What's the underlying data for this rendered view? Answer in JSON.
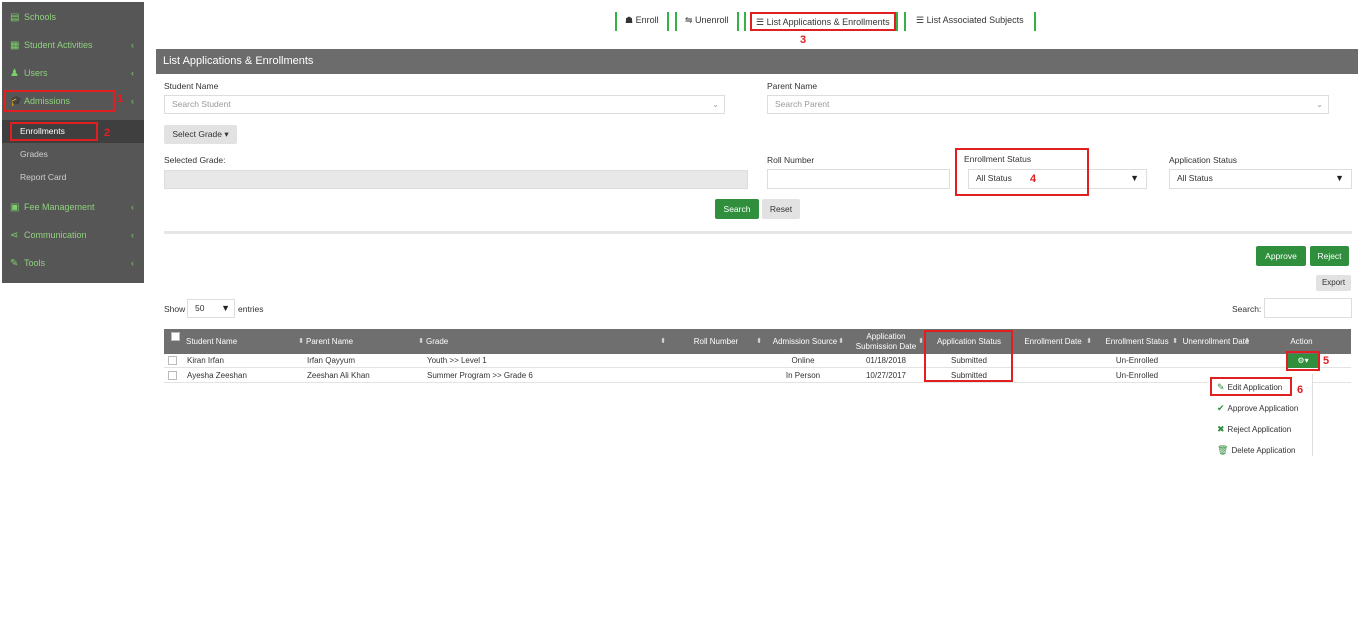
{
  "sidebar": {
    "items": [
      {
        "label": "Schools",
        "icon": "school-icon"
      },
      {
        "label": "Student Activities",
        "icon": "activities-icon"
      },
      {
        "label": "Users",
        "icon": "users-icon"
      },
      {
        "label": "Admissions",
        "icon": "graduation-cap-icon"
      },
      {
        "label": "Fee Management",
        "icon": "fee-icon"
      },
      {
        "label": "Communication",
        "icon": "share-icon"
      },
      {
        "label": "Tools",
        "icon": "wrench-icon"
      }
    ],
    "subitems": [
      "Enrollments",
      "Grades",
      "Report Card"
    ]
  },
  "top_tabs": [
    "Enroll",
    "Unenroll",
    "List Applications & Enrollments",
    "List Associated Subjects"
  ],
  "annotations": [
    "1",
    "2",
    "3",
    "4",
    "5",
    "6"
  ],
  "panel": {
    "title": "List Applications & Enrollments",
    "student_name_label": "Student Name",
    "student_name_placeholder": "Search Student",
    "parent_name_label": "Parent Name",
    "parent_name_placeholder": "Search Parent",
    "select_grade_button": "Select Grade",
    "selected_grade_label": "Selected Grade:",
    "roll_number_label": "Roll Number",
    "enrollment_status_label": "Enrollment Status",
    "enrollment_status_value": "All Status",
    "application_status_label": "Application Status",
    "application_status_value": "All Status",
    "search_button": "Search",
    "reset_button": "Reset",
    "approve_button": "Approve",
    "reject_button": "Reject",
    "export_button": "Export",
    "show_label": "Show",
    "entries_value": "50",
    "entries_label": "entries",
    "search_label": "Search:"
  },
  "table": {
    "headers": [
      "Student Name",
      "Parent Name",
      "Grade",
      "Roll Number",
      "Admission Source",
      "Application Submission Date",
      "Application Status",
      "Enrollment Date",
      "Enrollment Status",
      "Unenrollment Date",
      "Action"
    ],
    "rows": [
      {
        "student": "Kiran Irfan",
        "parent": "Irfan Qayyum",
        "grade": "Youth >> Level 1",
        "roll": "",
        "source": "Online",
        "submitted": "01/18/2018",
        "app_status": "Submitted",
        "enroll_date": "",
        "enroll_status": "Un-Enrolled",
        "unenroll_date": ""
      },
      {
        "student": "Ayesha Zeeshan",
        "parent": "Zeeshan Ali Khan",
        "grade": "Summer Program >> Grade 6",
        "roll": "",
        "source": "In Person",
        "submitted": "10/27/2017",
        "app_status": "Submitted",
        "enroll_date": "",
        "enroll_status": "Un-Enrolled",
        "unenroll_date": ""
      }
    ]
  },
  "action_menu": [
    "Edit Application",
    "Approve Application",
    "Reject Application",
    "Delete Application"
  ],
  "colors": {
    "accent_green": "#2f8f3c",
    "sidebar_bg": "#565656",
    "annotation_red": "#e02020"
  }
}
